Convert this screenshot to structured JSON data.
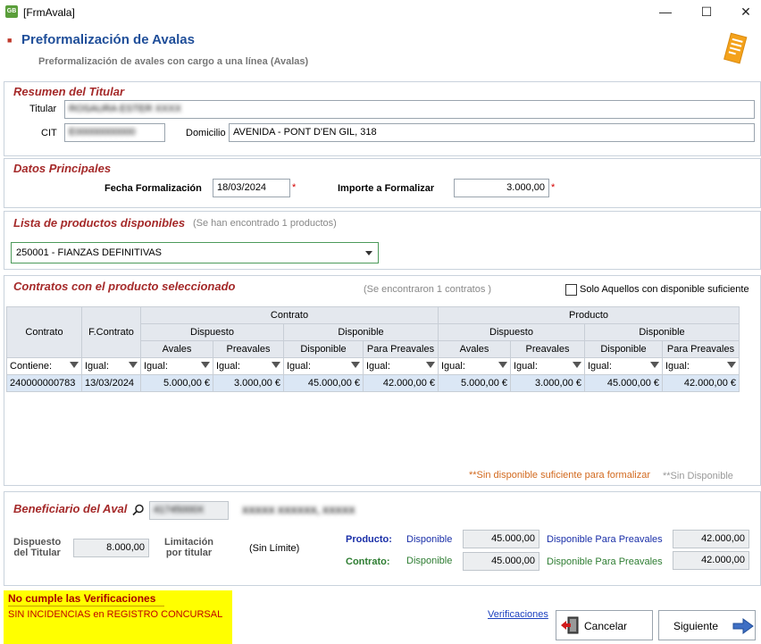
{
  "window": {
    "icon_text": "GB",
    "title": "[FrmAvala]",
    "minimize": "—",
    "maximize": "☐",
    "close": "✕"
  },
  "header": {
    "title": "Preformalización de Avalas",
    "subtitle": "Preformalización de avales con cargo a una línea (Avalas)",
    "icon": "document-icon"
  },
  "resumen": {
    "title": "Resumen del Titular",
    "titular_label": "Titular",
    "titular_value": "ROSAURA ESTER XXXX",
    "cit_label": "CIT",
    "cit_value": "E00000000000",
    "domicilio_label": "Domicilio",
    "domicilio_value": "AVENIDA - PONT D'EN GIL, 318"
  },
  "datos": {
    "title": "Datos Principales",
    "fecha_label": "Fecha Formalización",
    "fecha_value": "18/03/2024",
    "importe_label": "Importe a Formalizar",
    "importe_value": "3.000,00",
    "required": "*"
  },
  "productos": {
    "title": "Lista de productos disponibles",
    "count_text": "(Se han encontrado 1 productos)",
    "selected": "250001 - FIANZAS DEFINITIVAS"
  },
  "contratos": {
    "title": "Contratos con el producto seleccionado",
    "count_text": "(Se encontraron 1 contratos )",
    "checkbox_label": "Solo Aquellos con disponible suficiente",
    "headers": {
      "contrato": "Contrato",
      "fcontrato": "F.Contrato",
      "group_contrato": "Contrato",
      "group_producto": "Producto",
      "dispuesto": "Dispuesto",
      "disponible": "Disponible",
      "avales": "Avales",
      "preavales": "Preavales",
      "disponible_sub": "Disponible",
      "para_preavales": "Para Preavales"
    },
    "filters": [
      "Contiene:",
      "Igual:",
      "Igual:",
      "Igual:",
      "Igual:",
      "Igual:",
      "Igual:",
      "Igual:",
      "Igual:",
      "Igual:"
    ],
    "rows": [
      [
        "240000000783",
        "13/03/2024",
        "5.000,00 €",
        "3.000,00 €",
        "45.000,00 €",
        "42.000,00 €",
        "5.000,00 €",
        "3.000,00 €",
        "45.000,00 €",
        "42.000,00 €"
      ]
    ],
    "legend_orange": "**Sin disponible suficiente para formalizar",
    "legend_gray": "**Sin Disponible",
    "colors": {
      "legend_orange": "#d2691e",
      "legend_gray": "#999999"
    }
  },
  "beneficiario": {
    "title": "Beneficiario del Aval",
    "search_icon": "search-icon",
    "id_value": "41745000X",
    "name_value": "XXXXX XXXXXX, XXXXX",
    "dispuesto_label_1": "Dispuesto",
    "dispuesto_label_2": "del Titular",
    "dispuesto_value": "8.000,00",
    "limitacion_label_1": "Limitación",
    "limitacion_label_2": "por titular",
    "limitacion_value": "(Sin Límite)",
    "producto_label": "Producto:",
    "contrato_label": "Contrato:",
    "disponible_label": "Disponible",
    "para_preavales_label": "Disponible Para Preavales",
    "producto_disponible": "45.000,00",
    "producto_preavales": "42.000,00",
    "contrato_disponible": "45.000,00",
    "contrato_preavales": "42.000,00"
  },
  "footer": {
    "warning_title": "No cumple las Verificaciones",
    "warning_detail": "SIN INCIDENCIAS en REGISTRO CONCURSAL",
    "verificaciones_link": "Verificaciones",
    "cancel_label": "Cancelar",
    "next_label": "Siguiente"
  }
}
